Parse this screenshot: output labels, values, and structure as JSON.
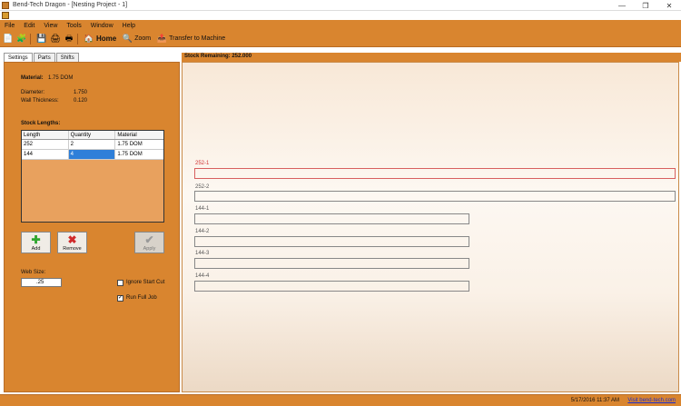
{
  "window": {
    "title": "Bend-Tech Dragon - [Nesting Project - 1]",
    "controls": {
      "minimize": "—",
      "maximize": "❐",
      "close": "✕"
    }
  },
  "menu": [
    "File",
    "Edit",
    "View",
    "Tools",
    "Window",
    "Help"
  ],
  "toolbar": {
    "home_label": "Home",
    "zoom_label": "Zoom",
    "transfer_label": "Transfer to Machine"
  },
  "tabs": [
    "Settings",
    "Parts",
    "Shifts"
  ],
  "settings": {
    "material_label": "Material:",
    "material_value": "1.75 DOM",
    "diameter_label": "Diameter:",
    "diameter_value": "1.750",
    "wall_label": "Wall Thickness:",
    "wall_value": "0.120",
    "stock_lengths_label": "Stock Lengths:",
    "grid_headers": [
      "Length",
      "Quantity",
      "Material"
    ],
    "grid_rows": [
      [
        "252",
        "2",
        "1.75 DOM"
      ],
      [
        "144",
        "4",
        "1.75 DOM"
      ]
    ],
    "add_label": "Add",
    "remove_label": "Remove",
    "apply_label": "Apply",
    "web_size_label": "Web Size:",
    "web_size_value": ".25",
    "ignore_start_cut_label": "Ignore Start Cut",
    "ignore_start_cut_checked": false,
    "run_full_job_label": "Run Full Job",
    "run_full_job_checked": true
  },
  "nest": {
    "stock_remaining": "Stock Remaining: 252.000",
    "bars": [
      {
        "label": "252-1",
        "highlight": true
      },
      {
        "label": "252-2",
        "highlight": false
      },
      {
        "label": "144-1",
        "highlight": false
      },
      {
        "label": "144-2",
        "highlight": false
      },
      {
        "label": "144-3",
        "highlight": false
      },
      {
        "label": "144-4",
        "highlight": false
      }
    ]
  },
  "status": {
    "datetime": "5/17/2016   11:37 AM",
    "link": "Visit bend-tech.com"
  },
  "colors": {
    "accent": "#d9852f",
    "highlight_bar": "#d86060",
    "selection": "#2f7fd9"
  }
}
